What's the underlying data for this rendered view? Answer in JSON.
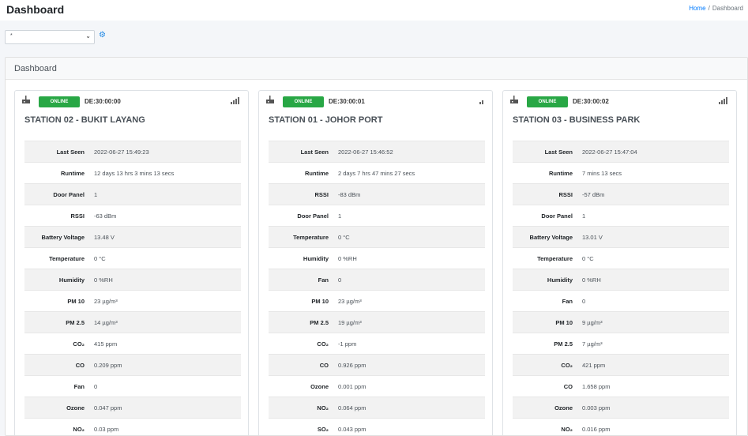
{
  "header": {
    "title": "Dashboard",
    "breadcrumb": [
      "Home",
      "Dashboard"
    ],
    "breadcrumb_sep": "/"
  },
  "filter": {
    "selected": "*",
    "chevron_icon": "chevron-down-icon",
    "settings_icon": "gear-icon"
  },
  "panel": {
    "title": "Dashboard"
  },
  "status_color": "#28a745",
  "stations": [
    {
      "status": "ONLINE",
      "device_id": "DE:30:00:00",
      "name": "STATION 02 - BUKIT LAYANG",
      "signal_bars": 4,
      "rows": [
        {
          "k": "Last Seen",
          "v": "2022-06-27 15:49:23"
        },
        {
          "k": "Runtime",
          "v": "12 days 13 hrs 3 mins 13 secs"
        },
        {
          "k": "Door Panel",
          "v": "1"
        },
        {
          "k": "RSSI",
          "v": "-63 dBm"
        },
        {
          "k": "Battery Voltage",
          "v": "13.48 V"
        },
        {
          "k": "Temperature",
          "v": "0 °C"
        },
        {
          "k": "Humidity",
          "v": "0 %RH"
        },
        {
          "k": "PM 10",
          "v": "23 µg/m³"
        },
        {
          "k": "PM 2.5",
          "v": "14 µg/m³"
        },
        {
          "k": "CO₂",
          "v": "415 ppm"
        },
        {
          "k": "CO",
          "v": "0.209 ppm"
        },
        {
          "k": "Fan",
          "v": "0"
        },
        {
          "k": "Ozone",
          "v": "0.047 ppm"
        },
        {
          "k": "NO₂",
          "v": "0.03 ppm"
        }
      ]
    },
    {
      "status": "ONLINE",
      "device_id": "DE:30:00:01",
      "name": "STATION 01 - JOHOR PORT",
      "signal_bars": 2,
      "rows": [
        {
          "k": "Last Seen",
          "v": "2022-06-27 15:46:52"
        },
        {
          "k": "Runtime",
          "v": "2 days 7 hrs 47 mins 27 secs"
        },
        {
          "k": "RSSI",
          "v": "-83 dBm"
        },
        {
          "k": "Door Panel",
          "v": "1"
        },
        {
          "k": "Temperature",
          "v": "0 °C"
        },
        {
          "k": "Humidity",
          "v": "0 %RH"
        },
        {
          "k": "Fan",
          "v": "0"
        },
        {
          "k": "PM 10",
          "v": "23 µg/m³"
        },
        {
          "k": "PM 2.5",
          "v": "19 µg/m³"
        },
        {
          "k": "CO₂",
          "v": "-1 ppm"
        },
        {
          "k": "CO",
          "v": "0.926 ppm"
        },
        {
          "k": "Ozone",
          "v": "0.001 ppm"
        },
        {
          "k": "NO₂",
          "v": "0.064 ppm"
        },
        {
          "k": "SO₂",
          "v": "0.043 ppm"
        }
      ]
    },
    {
      "status": "ONLINE",
      "device_id": "DE:30:00:02",
      "name": "STATION 03 - BUSINESS PARK",
      "signal_bars": 4,
      "rows": [
        {
          "k": "Last Seen",
          "v": "2022-06-27 15:47:04"
        },
        {
          "k": "Runtime",
          "v": "7 mins 13 secs"
        },
        {
          "k": "RSSI",
          "v": "-57 dBm"
        },
        {
          "k": "Door Panel",
          "v": "1"
        },
        {
          "k": "Battery Voltage",
          "v": "13.01 V"
        },
        {
          "k": "Temperature",
          "v": "0 °C"
        },
        {
          "k": "Humidity",
          "v": "0 %RH"
        },
        {
          "k": "Fan",
          "v": "0"
        },
        {
          "k": "PM 10",
          "v": "9 µg/m³"
        },
        {
          "k": "PM 2.5",
          "v": "7 µg/m³"
        },
        {
          "k": "CO₂",
          "v": "421 ppm"
        },
        {
          "k": "CO",
          "v": "1.658 ppm"
        },
        {
          "k": "Ozone",
          "v": "0.003 ppm"
        },
        {
          "k": "NO₂",
          "v": "0.016 ppm"
        }
      ]
    }
  ]
}
